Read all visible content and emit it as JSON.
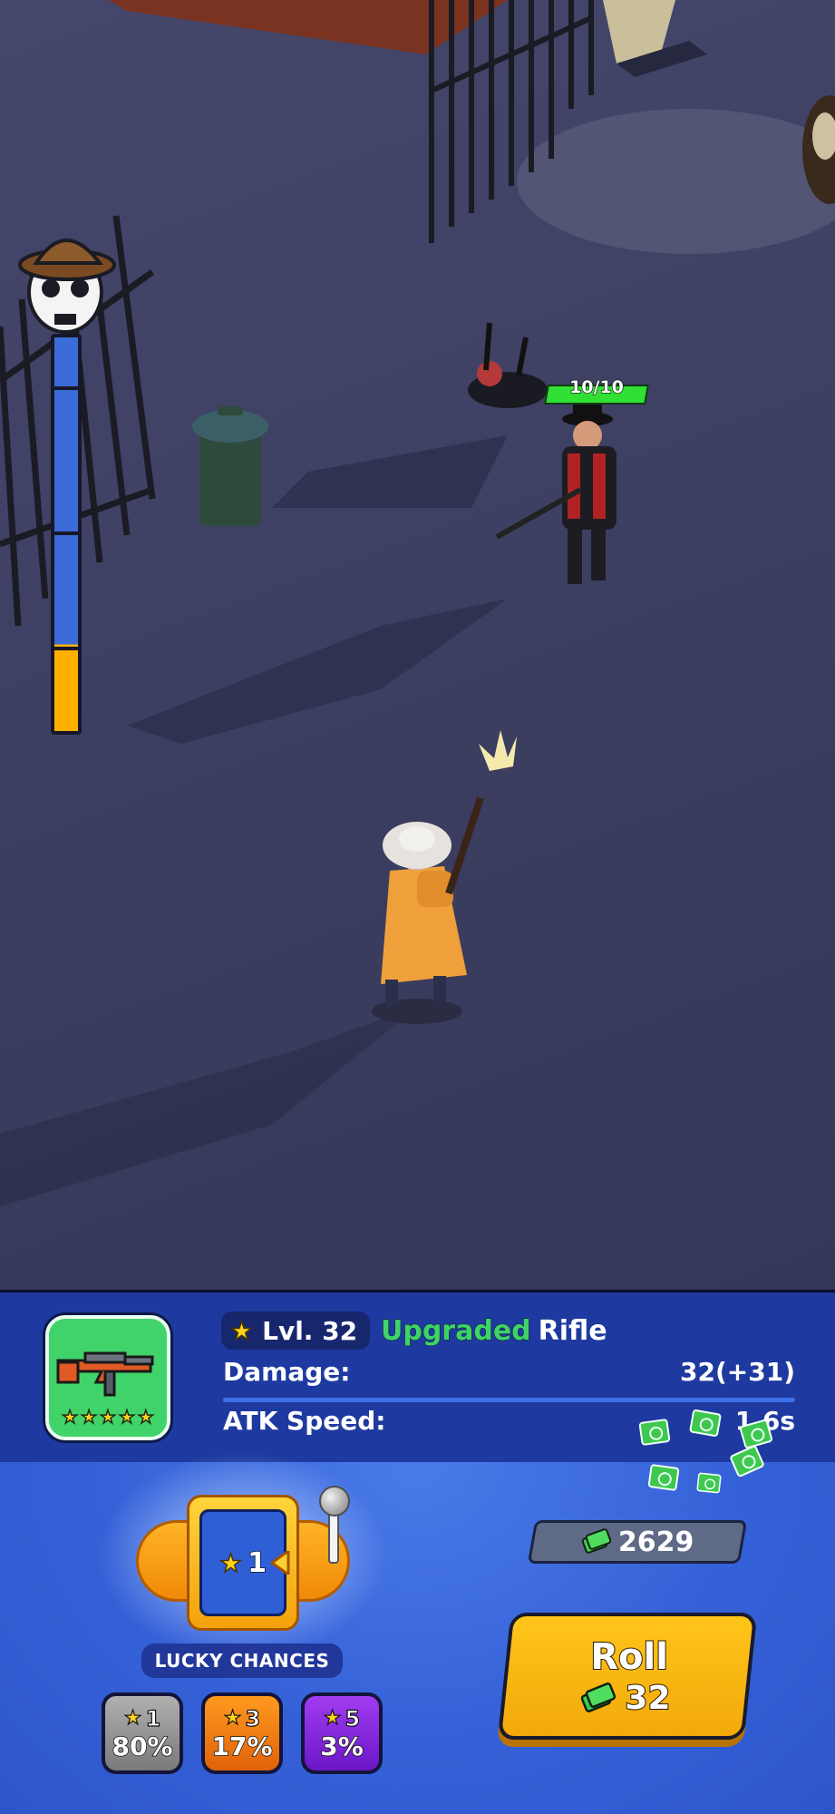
{
  "hud": {
    "boss_icon": "skull-fedora-icon",
    "wave_progress": 0.22,
    "enemy_hp": {
      "label": "10/10",
      "fraction": 1.0
    }
  },
  "weapon": {
    "icon": "rifle-icon",
    "rarity_stars": 1,
    "max_stars": 5,
    "level_label": "Lvl. 32",
    "name_prefix": "Upgraded",
    "name": "Rifle",
    "stats": [
      {
        "label": "Damage:",
        "value": "32(+31)"
      },
      {
        "label": "ATK Speed:",
        "value": "1.6s"
      }
    ]
  },
  "currency": {
    "icon": "cash-icon",
    "balance": "2629"
  },
  "roll": {
    "label": "Roll",
    "cost": "32"
  },
  "slot": {
    "current_rank": "1"
  },
  "lucky": {
    "title": "LUCKY CHANCES",
    "chances": [
      {
        "stars": "1",
        "percent": "80%",
        "color": "#9a9a9a"
      },
      {
        "stars": "3",
        "percent": "17%",
        "color": "#f07c10"
      },
      {
        "stars": "5",
        "percent": "3%",
        "color": "#8a2be2"
      }
    ]
  },
  "colors": {
    "accent_green": "#3fd36a",
    "panel_blue": "#1e3aa0",
    "button_yellow": "#f7b515",
    "progress_orange": "#ffb000"
  }
}
